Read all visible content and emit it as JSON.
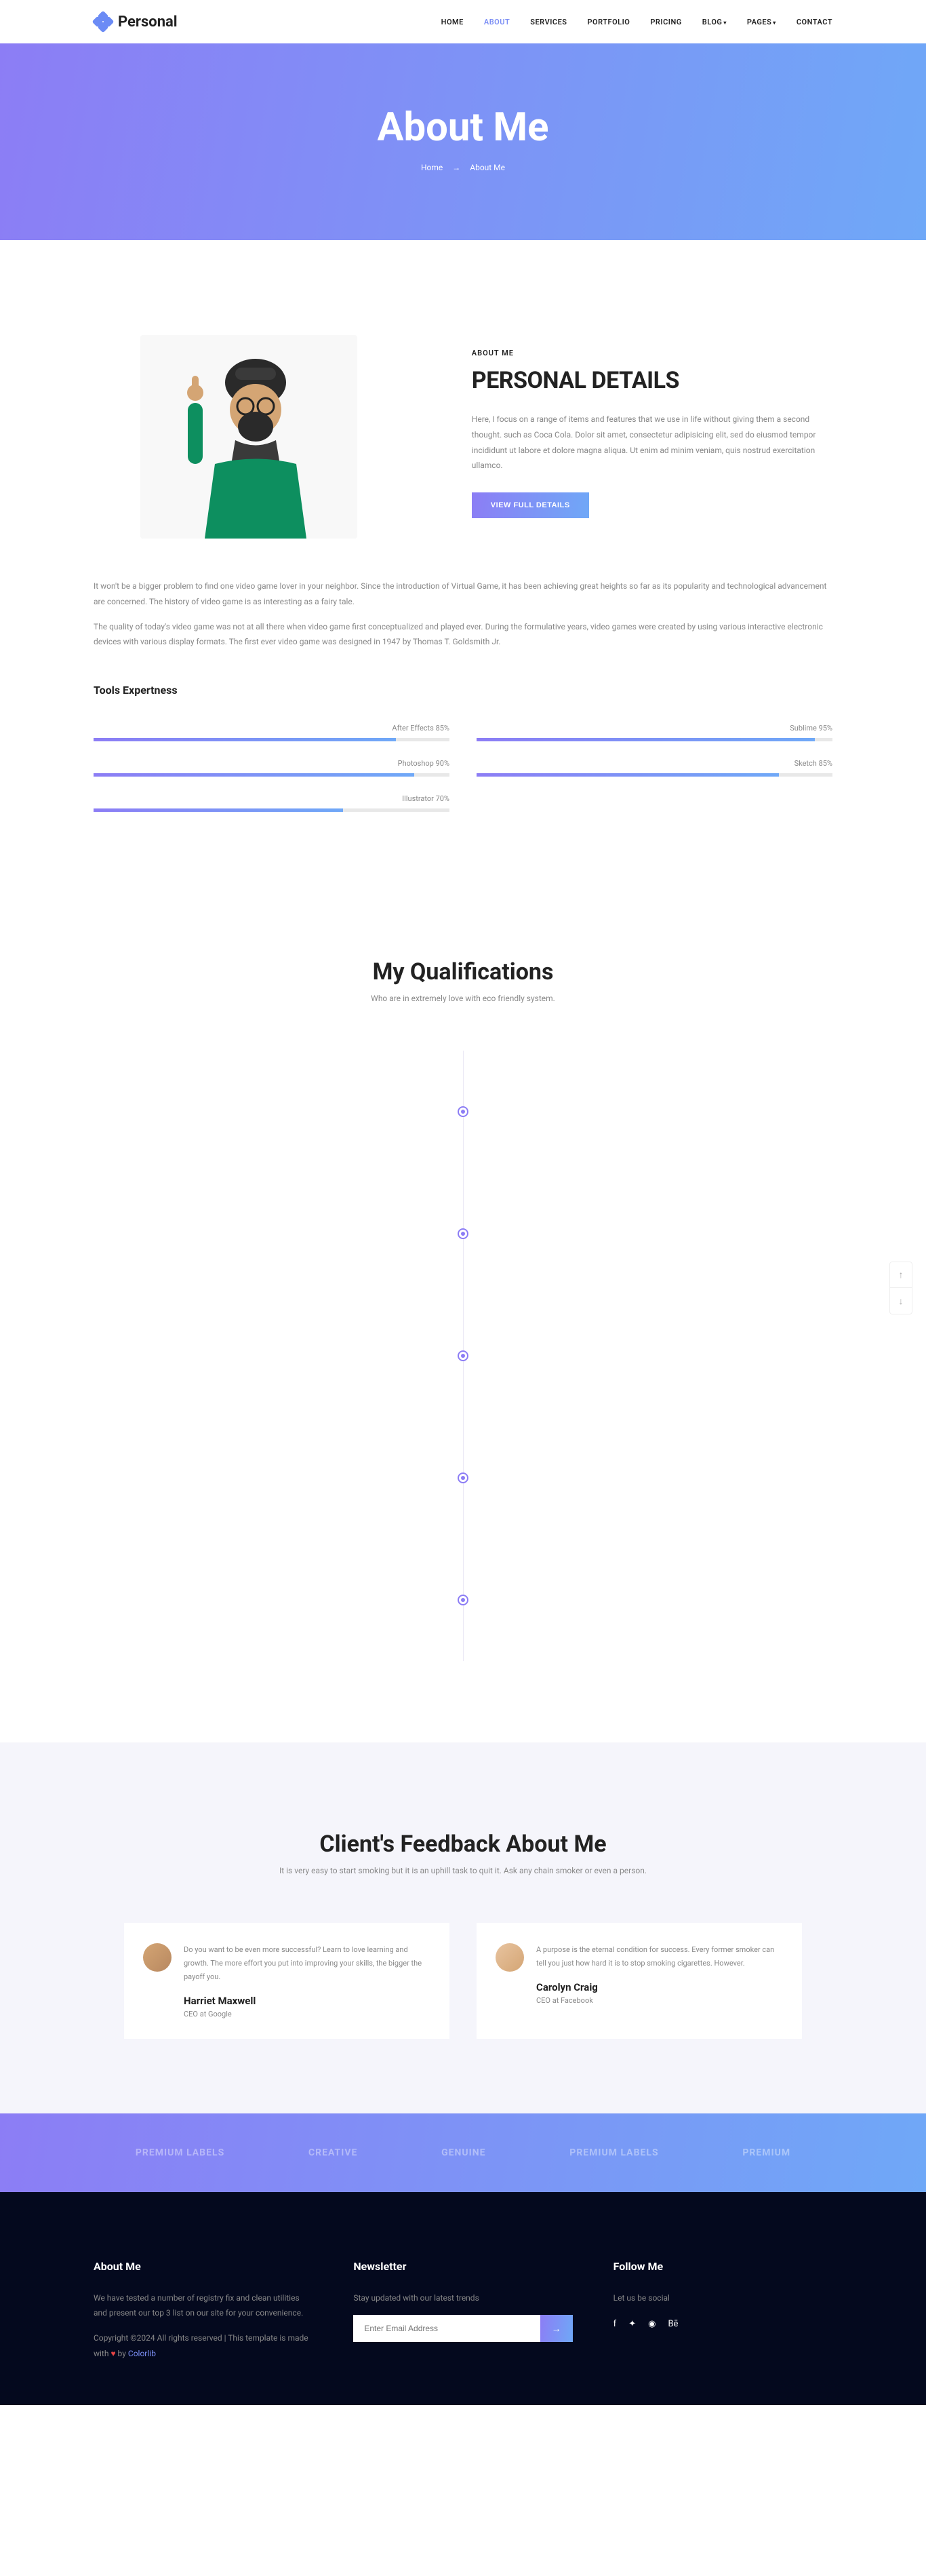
{
  "site": {
    "name": "Personal"
  },
  "nav": {
    "items": [
      "HOME",
      "ABOUT",
      "SERVICES",
      "PORTFOLIO",
      "PRICING",
      "BLOG",
      "PAGES",
      "CONTACT"
    ],
    "active": "ABOUT"
  },
  "banner": {
    "title": "About Me",
    "crumb_home": "Home",
    "crumb_current": "About Me"
  },
  "about": {
    "eyebrow": "ABOUT ME",
    "heading": "PERSONAL DETAILS",
    "intro": "Here, I focus on a range of items and features that we use in life without giving them a second thought. such as Coca Cola. Dolor sit amet, consectetur adipisicing elit, sed do eiusmod tempor incididunt ut labore et dolore magna aliqua. Ut enim ad minim veniam, quis nostrud exercitation ullamco.",
    "button": "VIEW FULL DETAILS",
    "p1": "It won't be a bigger problem to find one video game lover in your neighbor. Since the introduction of Virtual Game, it has been achieving great heights so far as its popularity and technological advancement are concerned. The history of video game is as interesting as a fairy tale.",
    "p2": "The quality of today's video game was not at all there when video game first conceptualized and played ever. During the formulative years, video games were created by using various interactive electronic devices with various display formats. The first ever video game was designed in 1947 by Thomas T. Goldsmith Jr."
  },
  "skills": {
    "title": "Tools Expertness",
    "left": [
      {
        "label": "After Effects 85%",
        "pct": 85
      },
      {
        "label": "Photoshop 90%",
        "pct": 90
      },
      {
        "label": "Illustrator 70%",
        "pct": 70
      }
    ],
    "right": [
      {
        "label": "Sublime 95%",
        "pct": 95
      },
      {
        "label": "Sketch 85%",
        "pct": 85
      }
    ]
  },
  "quals": {
    "title": "My Qualifications",
    "sub": "Who are in extremely love with eco friendly system."
  },
  "feedback": {
    "title": "Client's Feedback About Me",
    "sub": "It is very easy to start smoking but it is an uphill task to quit it. Ask any chain smoker or even a person.",
    "reviews": [
      {
        "text": "Do you want to be even more successful? Learn to love learning and growth. The more effort you put into improving your skills, the bigger the payoff you.",
        "name": "Harriet Maxwell",
        "role": "CEO at Google"
      },
      {
        "text": "A purpose is the eternal condition for success. Every former smoker can tell you just how hard it is to stop smoking cigarettes. However.",
        "name": "Carolyn Craig",
        "role": "CEO at Facebook"
      }
    ]
  },
  "brands": [
    "PREMIUM LABELS",
    "CREATIVE",
    "GENUINE",
    "PREMIUM LABELS",
    "PREMIUM"
  ],
  "footer": {
    "about_h": "About Me",
    "about_p": "We have tested a number of registry fix and clean utilities and present our top 3 list on our site for your convenience.",
    "copyright_1": "Copyright ©2024 All rights reserved | This template is made with ",
    "copyright_2": " by ",
    "colorlib": "Colorlib",
    "nl_h": "Newsletter",
    "nl_p": "Stay updated with our latest trends",
    "nl_placeholder": "Enter Email Address",
    "follow_h": "Follow Me",
    "follow_p": "Let us be social"
  }
}
